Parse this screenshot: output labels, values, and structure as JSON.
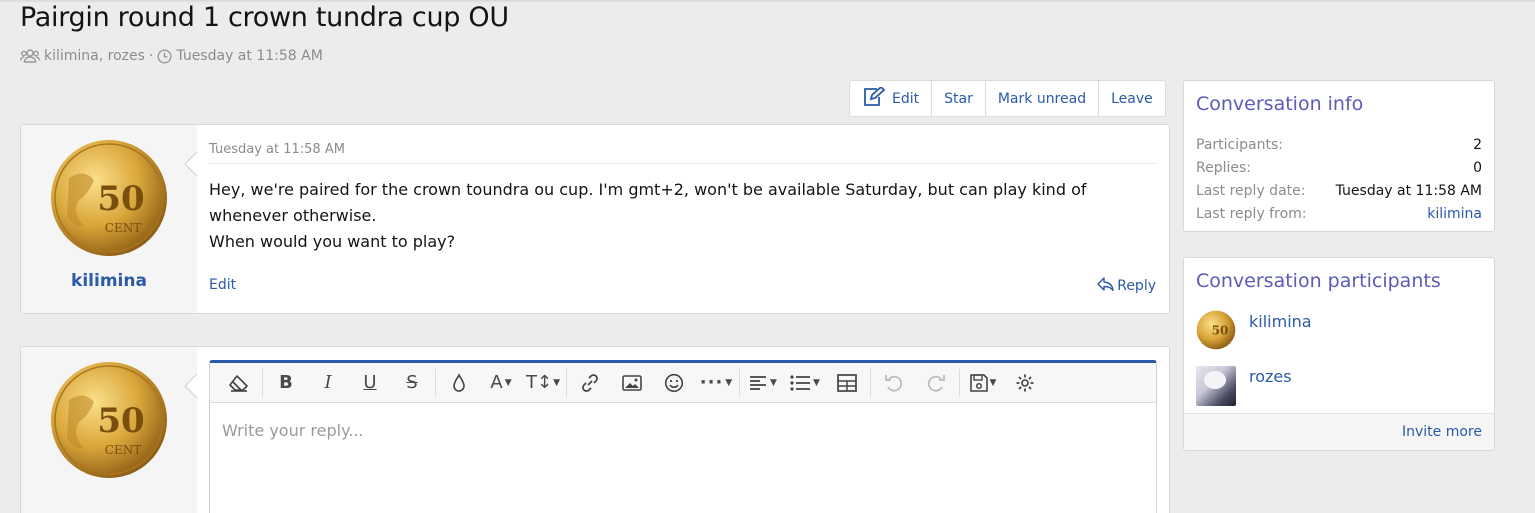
{
  "page": {
    "title": "Pairgin round 1 crown tundra cup OU",
    "participants_meta": "kilimina, rozes",
    "date_meta": "Tuesday at 11:58 AM"
  },
  "actions": {
    "edit_label": "Edit",
    "star_label": "Star",
    "mark_unread_label": "Mark unread",
    "leave_label": "Leave"
  },
  "message": {
    "author": "kilimina",
    "time": "Tuesday at 11:58 AM",
    "line1": "Hey, we're paired for the crown toundra ou cup. I'm gmt+2, won't be available Saturday, but can play kind of whenever otherwise.",
    "line2": "When would you want to play?",
    "edit_label": "Edit",
    "reply_label": "Reply"
  },
  "reply_editor": {
    "placeholder": "Write your reply...",
    "toolbar": [
      "eraser-icon",
      "bold-icon",
      "italic-icon",
      "underline-icon",
      "strikethrough-icon",
      "text-color-icon",
      "font-size-icon",
      "text-size-icon",
      "link-icon",
      "image-icon",
      "emoji-icon",
      "more-icon",
      "align-icon",
      "list-icon",
      "table-icon",
      "undo-icon",
      "redo-icon",
      "save-drafts-icon",
      "settings-icon"
    ]
  },
  "conversation_info": {
    "title": "Conversation info",
    "rows": [
      {
        "label": "Participants:",
        "value": "2"
      },
      {
        "label": "Replies:",
        "value": "0"
      },
      {
        "label": "Last reply date:",
        "value": "Tuesday at 11:58 AM"
      },
      {
        "label": "Last reply from:",
        "value": "kilimina"
      }
    ]
  },
  "conversation_participants": {
    "title": "Conversation participants",
    "participants": [
      "kilimina",
      "rozes"
    ],
    "invite_label": "Invite more"
  },
  "colors": {
    "link": "#2a5aa8",
    "sidebar_title": "#5b5bb8",
    "background": "#ececec"
  }
}
